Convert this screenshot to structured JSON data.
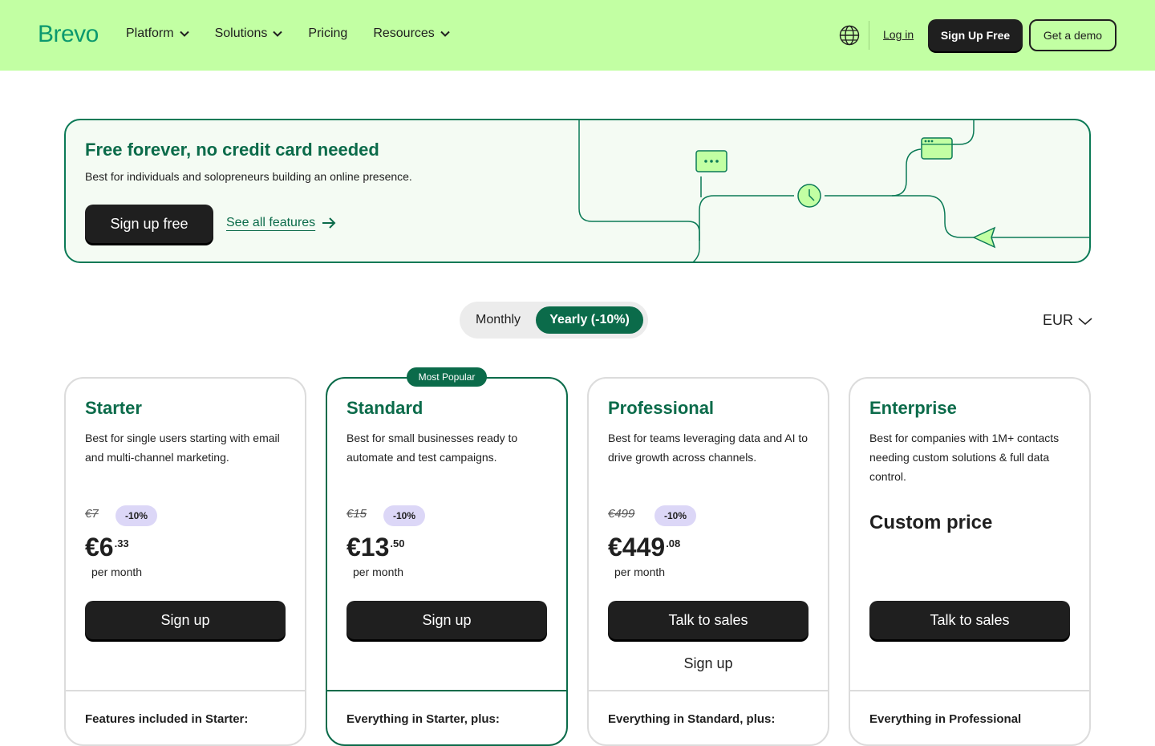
{
  "brand": {
    "name": "Brevo",
    "green": "#0b996e",
    "dark_green": "#0b6b4a",
    "header_bg": "#c2ffa3"
  },
  "nav": {
    "items": [
      {
        "label": "Platform",
        "dropdown": true
      },
      {
        "label": "Solutions",
        "dropdown": true
      },
      {
        "label": "Pricing",
        "dropdown": false
      },
      {
        "label": "Resources",
        "dropdown": true
      }
    ],
    "language_icon": "globe-icon",
    "login": "Log in",
    "signup": "Sign Up Free",
    "demo": "Get a demo"
  },
  "free_banner": {
    "title": "Free forever, no credit card needed",
    "subtitle": "Best for individuals and solopreneurs building an online presence.",
    "signup": "Sign up free",
    "see_all": "See all features"
  },
  "billing": {
    "monthly": "Monthly",
    "yearly": "Yearly (-10%)",
    "selected": "yearly",
    "currency": "EUR"
  },
  "plans": [
    {
      "name": "Starter",
      "description": "Best for single users starting with email and multi-channel marketing.",
      "old_price": "€7",
      "discount": "-10%",
      "price_main": "€6",
      "price_cents": ".33",
      "per": "per month",
      "cta": "Sign up",
      "features_heading": "Features included in Starter:"
    },
    {
      "name": "Standard",
      "badge": "Most Popular",
      "description": "Best for small businesses ready to automate and test campaigns.",
      "old_price": "€15",
      "discount": "-10%",
      "price_main": "€13",
      "price_cents": ".50",
      "per": "per month",
      "cta": "Sign up",
      "features_heading": "Everything in Starter, plus:"
    },
    {
      "name": "Professional",
      "description": "Best for teams leveraging data and AI to drive growth across channels.",
      "old_price": "€499",
      "discount": "-10%",
      "price_main": "€449",
      "price_cents": ".08",
      "per": "per month",
      "cta": "Talk to sales",
      "secondary": "Sign up",
      "features_heading": "Everything in Standard, plus:"
    },
    {
      "name": "Enterprise",
      "description": "Best for companies with 1M+ contacts needing custom solutions & full data control.",
      "custom_price": "Custom price",
      "cta": "Talk to sales",
      "features_heading": "Everything in Professional"
    }
  ]
}
